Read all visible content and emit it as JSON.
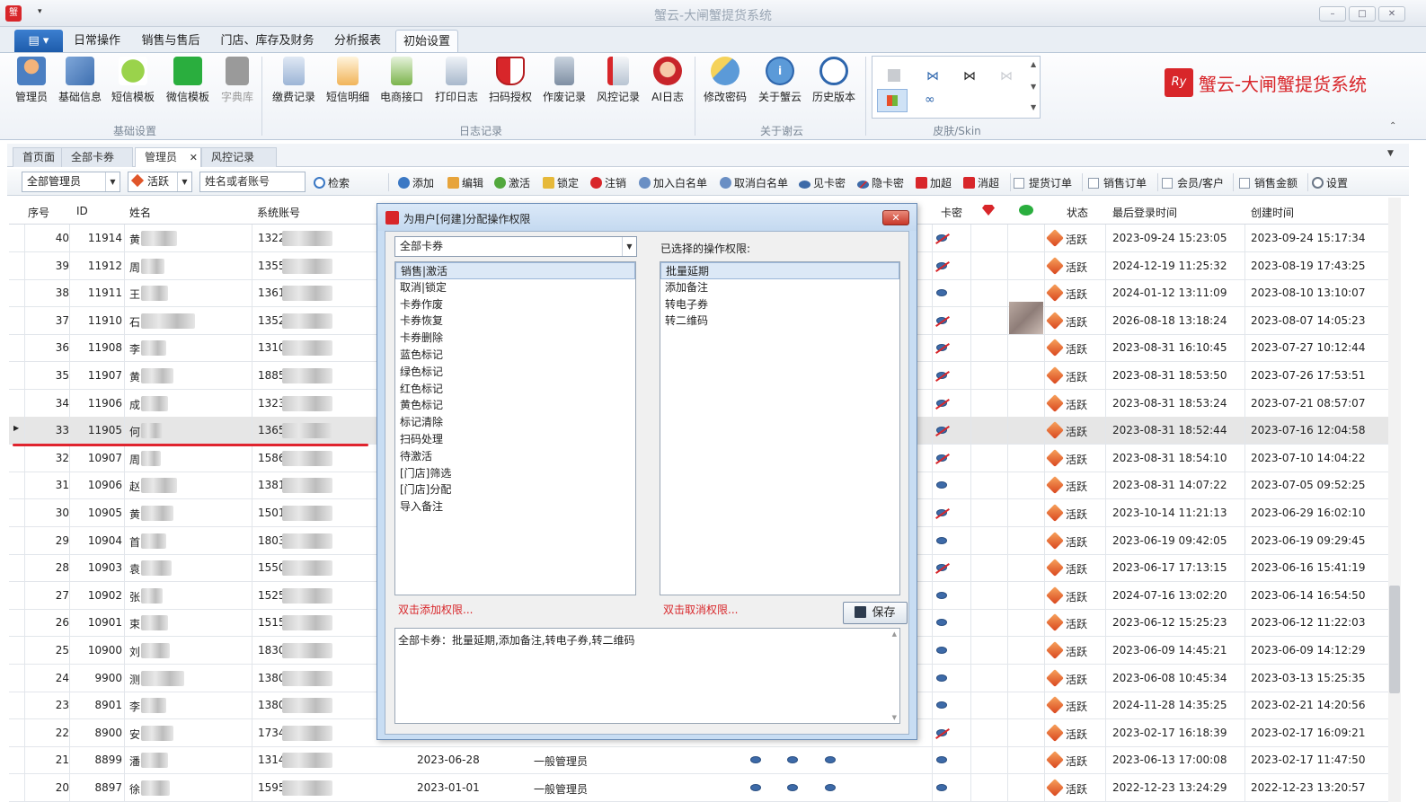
{
  "app": {
    "title": "蟹云-大闸蟹提货系统",
    "logo_text": "蟹云-大闸蟹提货系统"
  },
  "ribbon_tabs": [
    "日常操作",
    "销售与售后",
    "门店、库存及财务",
    "分析报表",
    "初始设置"
  ],
  "ribbon": {
    "groups": [
      {
        "label": "基础设置",
        "buttons": [
          "管理员",
          "基础信息",
          "短信模板",
          "微信模板",
          "字典库"
        ]
      },
      {
        "label": "日志记录",
        "buttons": [
          "缴费记录",
          "短信明细",
          "电商接口",
          "打印日志",
          "扫码授权",
          "作废记录",
          "风控记录",
          "AI日志"
        ]
      },
      {
        "label": "关于谢云",
        "buttons": [
          "修改密码",
          "关于蟹云",
          "历史版本"
        ]
      },
      {
        "label": "皮肤/Skin",
        "buttons": []
      }
    ]
  },
  "doc_tabs": [
    "首页面",
    "全部卡券",
    "管理员",
    "风控记录"
  ],
  "toolbar": {
    "filter_role": "全部管理员",
    "filter_status": "活跃",
    "search_placeholder": "姓名或者账号",
    "search_label": "检索",
    "actions": [
      "添加",
      "编辑",
      "激活",
      "锁定",
      "注销",
      "加入白名单",
      "取消白名单",
      "见卡密",
      "隐卡密",
      "加超",
      "消超"
    ],
    "checks": [
      "提货订单",
      "销售订单",
      "会员/客户",
      "销售金额"
    ],
    "settings_label": "设置"
  },
  "grid": {
    "headers": {
      "seq": "序号",
      "id": "ID",
      "name": "姓名",
      "account": "系统账号",
      "card": "卡密",
      "status": "状态",
      "last_login": "最后登录时间",
      "created": "创建时间"
    },
    "rows": [
      {
        "seq": "40",
        "id": "11914",
        "name": "黄",
        "status": "活跃",
        "last": "2023-09-24 15:23:05",
        "created": "2023-09-24 15:17:34",
        "acct": "1322"
      },
      {
        "seq": "39",
        "id": "11912",
        "name": "周",
        "status": "活跃",
        "last": "2024-12-19 11:25:32",
        "created": "2023-08-19 17:43:25",
        "acct": "1355"
      },
      {
        "seq": "38",
        "id": "11911",
        "name": "王",
        "status": "活跃",
        "last": "2024-01-12 13:11:09",
        "created": "2023-08-10 13:10:07",
        "acct": "1361"
      },
      {
        "seq": "37",
        "id": "11910",
        "name": "石",
        "status": "活跃",
        "last": "2026-08-18 13:18:24",
        "created": "2023-08-07 14:05:23",
        "acct": "1352"
      },
      {
        "seq": "36",
        "id": "11908",
        "name": "李",
        "status": "活跃",
        "last": "2023-08-31 16:10:45",
        "created": "2023-07-27 10:12:44",
        "acct": "1310"
      },
      {
        "seq": "35",
        "id": "11907",
        "name": "黄",
        "status": "活跃",
        "last": "2023-08-31 18:53:50",
        "created": "2023-07-26 17:53:51",
        "acct": "1885"
      },
      {
        "seq": "34",
        "id": "11906",
        "name": "成",
        "status": "活跃",
        "last": "2023-08-31 18:53:24",
        "created": "2023-07-21 08:57:07",
        "acct": "1323"
      },
      {
        "seq": "33",
        "id": "11905",
        "name": "何",
        "status": "活跃",
        "last": "2023-08-31 18:52:44",
        "created": "2023-07-16 12:04:58",
        "acct": "1365"
      },
      {
        "seq": "32",
        "id": "10907",
        "name": "周",
        "status": "活跃",
        "last": "2023-08-31 18:54:10",
        "created": "2023-07-10 14:04:22",
        "acct": "1586"
      },
      {
        "seq": "31",
        "id": "10906",
        "name": "赵",
        "status": "活跃",
        "last": "2023-08-31 14:07:22",
        "created": "2023-07-05 09:52:25",
        "acct": "1381"
      },
      {
        "seq": "30",
        "id": "10905",
        "name": "黄",
        "status": "活跃",
        "last": "2023-10-14 11:21:13",
        "created": "2023-06-29 16:02:10",
        "acct": "1501"
      },
      {
        "seq": "29",
        "id": "10904",
        "name": "首",
        "status": "活跃",
        "last": "2023-06-19 09:42:05",
        "created": "2023-06-19 09:29:45",
        "acct": "1803"
      },
      {
        "seq": "28",
        "id": "10903",
        "name": "袁",
        "status": "活跃",
        "last": "2023-06-17 17:13:15",
        "created": "2023-06-16 15:41:19",
        "acct": "1550"
      },
      {
        "seq": "27",
        "id": "10902",
        "name": "张",
        "status": "活跃",
        "last": "2024-07-16 13:02:20",
        "created": "2023-06-14 16:54:50",
        "acct": "1525"
      },
      {
        "seq": "26",
        "id": "10901",
        "name": "束",
        "status": "活跃",
        "last": "2023-06-12 15:25:23",
        "created": "2023-06-12 11:22:03",
        "acct": "1515"
      },
      {
        "seq": "25",
        "id": "10900",
        "name": "刘",
        "status": "活跃",
        "last": "2023-06-09 14:45:21",
        "created": "2023-06-09 14:12:29",
        "acct": "1830"
      },
      {
        "seq": "24",
        "id": "9900",
        "name": "测",
        "status": "活跃",
        "last": "2023-06-08 10:45:34",
        "created": "2023-03-13 15:25:35",
        "acct": "1380"
      },
      {
        "seq": "23",
        "id": "8901",
        "name": "李",
        "status": "活跃",
        "last": "2024-11-28 14:35:25",
        "created": "2023-02-21 14:20:56",
        "acct": "1380"
      },
      {
        "seq": "22",
        "id": "8900",
        "name": "安",
        "status": "活跃",
        "last": "2023-02-17 16:18:39",
        "created": "2023-02-17 16:09:21",
        "acct": "1734"
      },
      {
        "seq": "21",
        "id": "8899",
        "name": "潘",
        "status": "活跃",
        "last": "2023-06-13 17:00:08",
        "created": "2023-02-17 11:47:50",
        "acct": "1314",
        "date": "2023-06-28",
        "role": "一般管理员"
      },
      {
        "seq": "20",
        "id": "8897",
        "name": "徐",
        "status": "活跃",
        "last": "2022-12-23 13:24:29",
        "created": "2022-12-23 13:20:57",
        "acct": "1595",
        "date": "2023-01-01",
        "role": "一般管理员"
      }
    ]
  },
  "dialog": {
    "title": "为用户[何建]分配操作权限",
    "category": "全部卡券",
    "selected_label": "已选择的操作权限:",
    "available": [
      "销售|激活",
      "取消|锁定",
      "卡券作废",
      "卡券恢复",
      "卡券删除",
      "蓝色标记",
      "绿色标记",
      "红色标记",
      "黄色标记",
      "标记清除",
      "扫码处理",
      "待激活",
      "[门店]筛选",
      "[门店]分配",
      "导入备注"
    ],
    "selected": [
      "批量延期",
      "添加备注",
      "转电子券",
      "转二维码"
    ],
    "add_hint": "双击添加权限...",
    "remove_hint": "双击取消权限...",
    "save_label": "保存",
    "summary": "全部卡券：批量延期,添加备注,转电子券,转二维码"
  }
}
